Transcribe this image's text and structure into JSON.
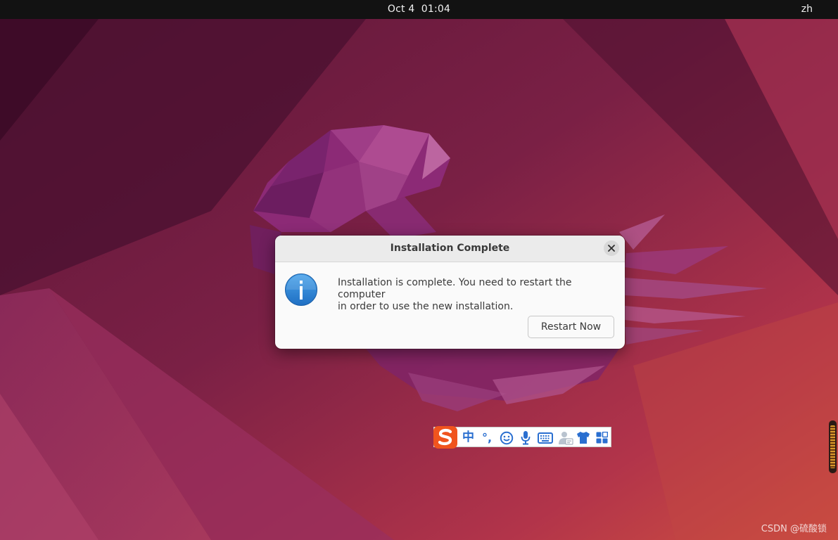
{
  "topbar": {
    "date": "Oct 4",
    "time": "01:04",
    "input_method_label": "zh"
  },
  "dialog": {
    "title": "Installation Complete",
    "message_line1": "Installation is complete. You need to restart the computer",
    "message_line2": "in order to use the new installation.",
    "restart_label": "Restart Now",
    "icon": "info-icon",
    "close_icon": "close-icon"
  },
  "ime_toolbar": {
    "logo": "sogou-logo-icon",
    "mode_label": "中",
    "punctuation_label": "°,",
    "icons": [
      "emoji-icon",
      "microphone-icon",
      "keyboard-icon",
      "user-card-icon",
      "skin-shirt-icon",
      "toolbox-icon"
    ]
  },
  "watermark": {
    "text": "CSDN @硫酸锁"
  },
  "colors": {
    "topbar_bg": "#121212",
    "dialog_bg": "#fafafa",
    "header_bg": "#ebebeb",
    "info_blue": "#2a7fd1",
    "ime_blue": "#2a6fd0",
    "sogou_orange": "#f0541e"
  }
}
